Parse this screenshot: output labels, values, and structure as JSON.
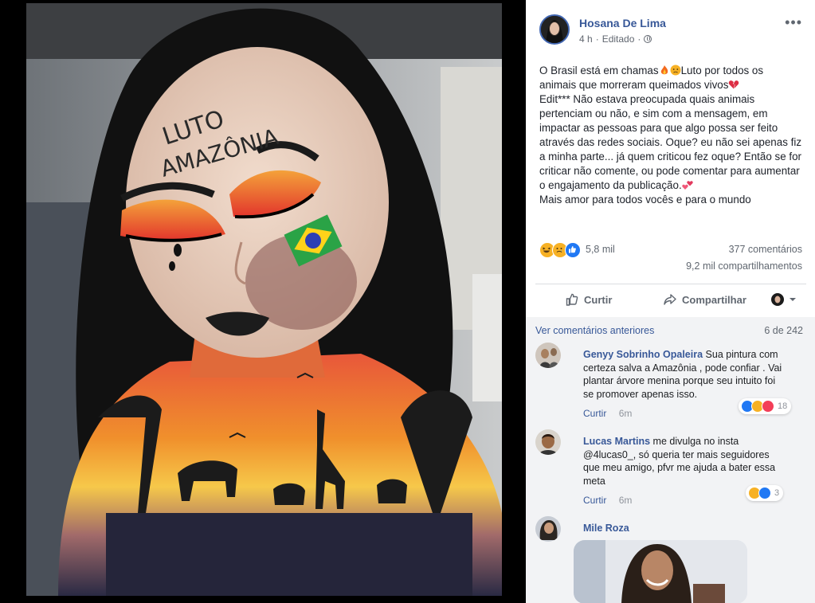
{
  "post": {
    "author": "Hosana De Lima",
    "time": "4 h",
    "edited": "Editado",
    "more_icon": "ellipsis-icon",
    "text_lines": [
      "O Brasil está em chamas",
      "Luto por todos os",
      "animais que morreram queimados vivos",
      "Edit*** Não estava preocupada quais animais pertenciam ou não, e sim com a mensagem, em impactar as pessoas para que algo possa ser feito através das redes sociais. Oque? eu não sei apenas fiz a minha parte... já quem criticou fez oque? Então se for criticar não comente, ou pode comentar para aumentar o engajamento da publicação.",
      "Mais amor para todos vocês e para o mundo"
    ],
    "photo_text": [
      "LUTO",
      "AMAZÔNIA"
    ]
  },
  "stats": {
    "reactions": "5,8 mil",
    "comments": "377 comentários",
    "shares": "9,2 mil compartilhamentos"
  },
  "actions": {
    "like": "Curtir",
    "share": "Compartilhar"
  },
  "comments_section": {
    "prev_link": "Ver comentários anteriores",
    "pager": "6 de 242",
    "items": [
      {
        "name": "Genyy Sobrinho Opaleira",
        "text": "Sua pintura com certeza salva a Amazônia , pode confiar . Vai plantar árvore menina porque seu intuito foi se promover apenas isso.",
        "like": "Curtir",
        "time": "6m",
        "reactions": "18"
      },
      {
        "name": "Lucas Martins",
        "text": "me divulga no insta @4lucas0_, só queria ter mais seguidores que meu amigo, pfvr me ajuda a bater essa meta",
        "like": "Curtir",
        "time": "6m",
        "reactions": "3"
      },
      {
        "name": "Mile Roza"
      }
    ]
  },
  "colors": {
    "link": "#385898",
    "accent": "#4267b2",
    "secondary_text": "#606770",
    "comment_bg": "#f2f3f5"
  }
}
